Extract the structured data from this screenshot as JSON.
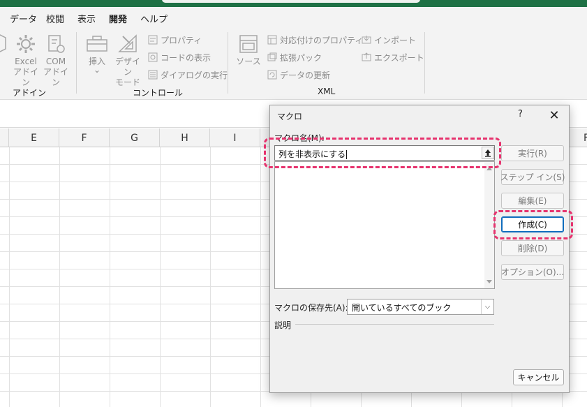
{
  "tabs": [
    {
      "label": "データ",
      "active": false
    },
    {
      "label": "校閲",
      "active": false
    },
    {
      "label": "表示",
      "active": false
    },
    {
      "label": "開発",
      "active": true
    },
    {
      "label": "ヘルプ",
      "active": false
    }
  ],
  "ribbon": {
    "addin_partial_label": "ド\nィ",
    "excel_addins_label": "Excel\nアドイン",
    "com_addins_label": "COM\nアドイン",
    "insert_label": "挿入",
    "insert_chevron": "⌄",
    "design_mode_label": "デザイン\nモード",
    "properties_label": "プロパティ",
    "view_code_label": "コードの表示",
    "run_dialog_label": "ダイアログの実行",
    "source_label": "ソース",
    "map_properties_label": "対応付けのプロパティ",
    "expansion_packs_label": "拡張パック",
    "refresh_data_label": "データの更新",
    "import_label": "インポート",
    "export_label": "エクスポート",
    "group_addins": "アドイン",
    "group_controls": "コントロール",
    "group_xml": "XML"
  },
  "sheet": {
    "columns": [
      "E",
      "F",
      "G",
      "H",
      "I",
      "F"
    ]
  },
  "dialog": {
    "title": "マクロ",
    "help": "?",
    "close": "✕",
    "macro_name_label": "マクロ名(M):",
    "macro_name_value": "列を非表示にする",
    "buttons": {
      "run": "実行(R)",
      "step_into": "ステップ イン(S)",
      "edit": "編集(E)",
      "create": "作成(C)",
      "delete": "削除(D)",
      "options": "オプション(O)..."
    },
    "macros_in_label": "マクロの保存先(A):",
    "macros_in_value": "開いているすべてのブック",
    "description_label": "説明",
    "cancel": "キャンセル"
  },
  "colors": {
    "accent_green": "#1e7145",
    "highlight_pink": "#e6336e",
    "default_button_border": "#0f6cbd"
  }
}
